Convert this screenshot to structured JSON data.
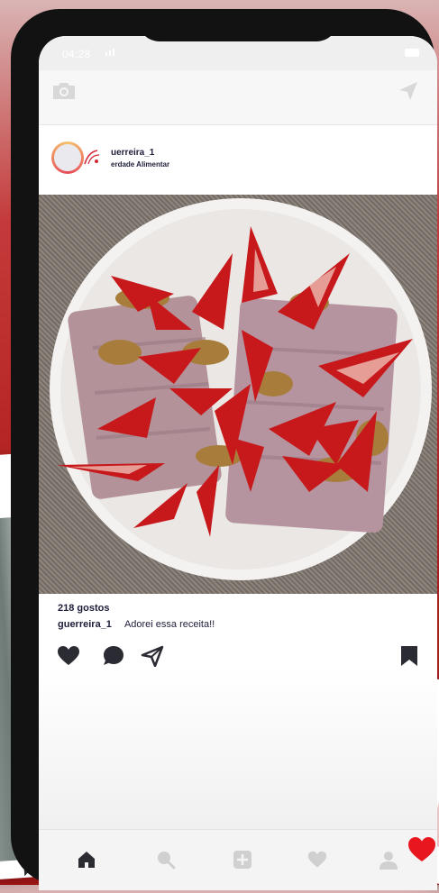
{
  "status_bar": {
    "time": "04:28"
  },
  "post": {
    "username": "uerreira_1",
    "subtitle": "erdade Alimentar",
    "likes": "218 gostos",
    "caption_user": "guerreira_1",
    "caption_text": "Adorei essa receita!!"
  },
  "icons": {
    "top": [
      "camera-icon",
      "send-icon"
    ],
    "actions": [
      "heart-icon",
      "comment-icon",
      "send-icon",
      "bookmark-icon"
    ],
    "nav": [
      "home-icon",
      "search-icon",
      "add-icon",
      "heart-icon",
      "profile-icon"
    ]
  },
  "colors": {
    "accent": "#e8171f",
    "text": "#1e1e3a",
    "background_red": "#b11d1d",
    "icon_gray": "#d8d8d8",
    "icon_dark": "#2b2b33"
  }
}
